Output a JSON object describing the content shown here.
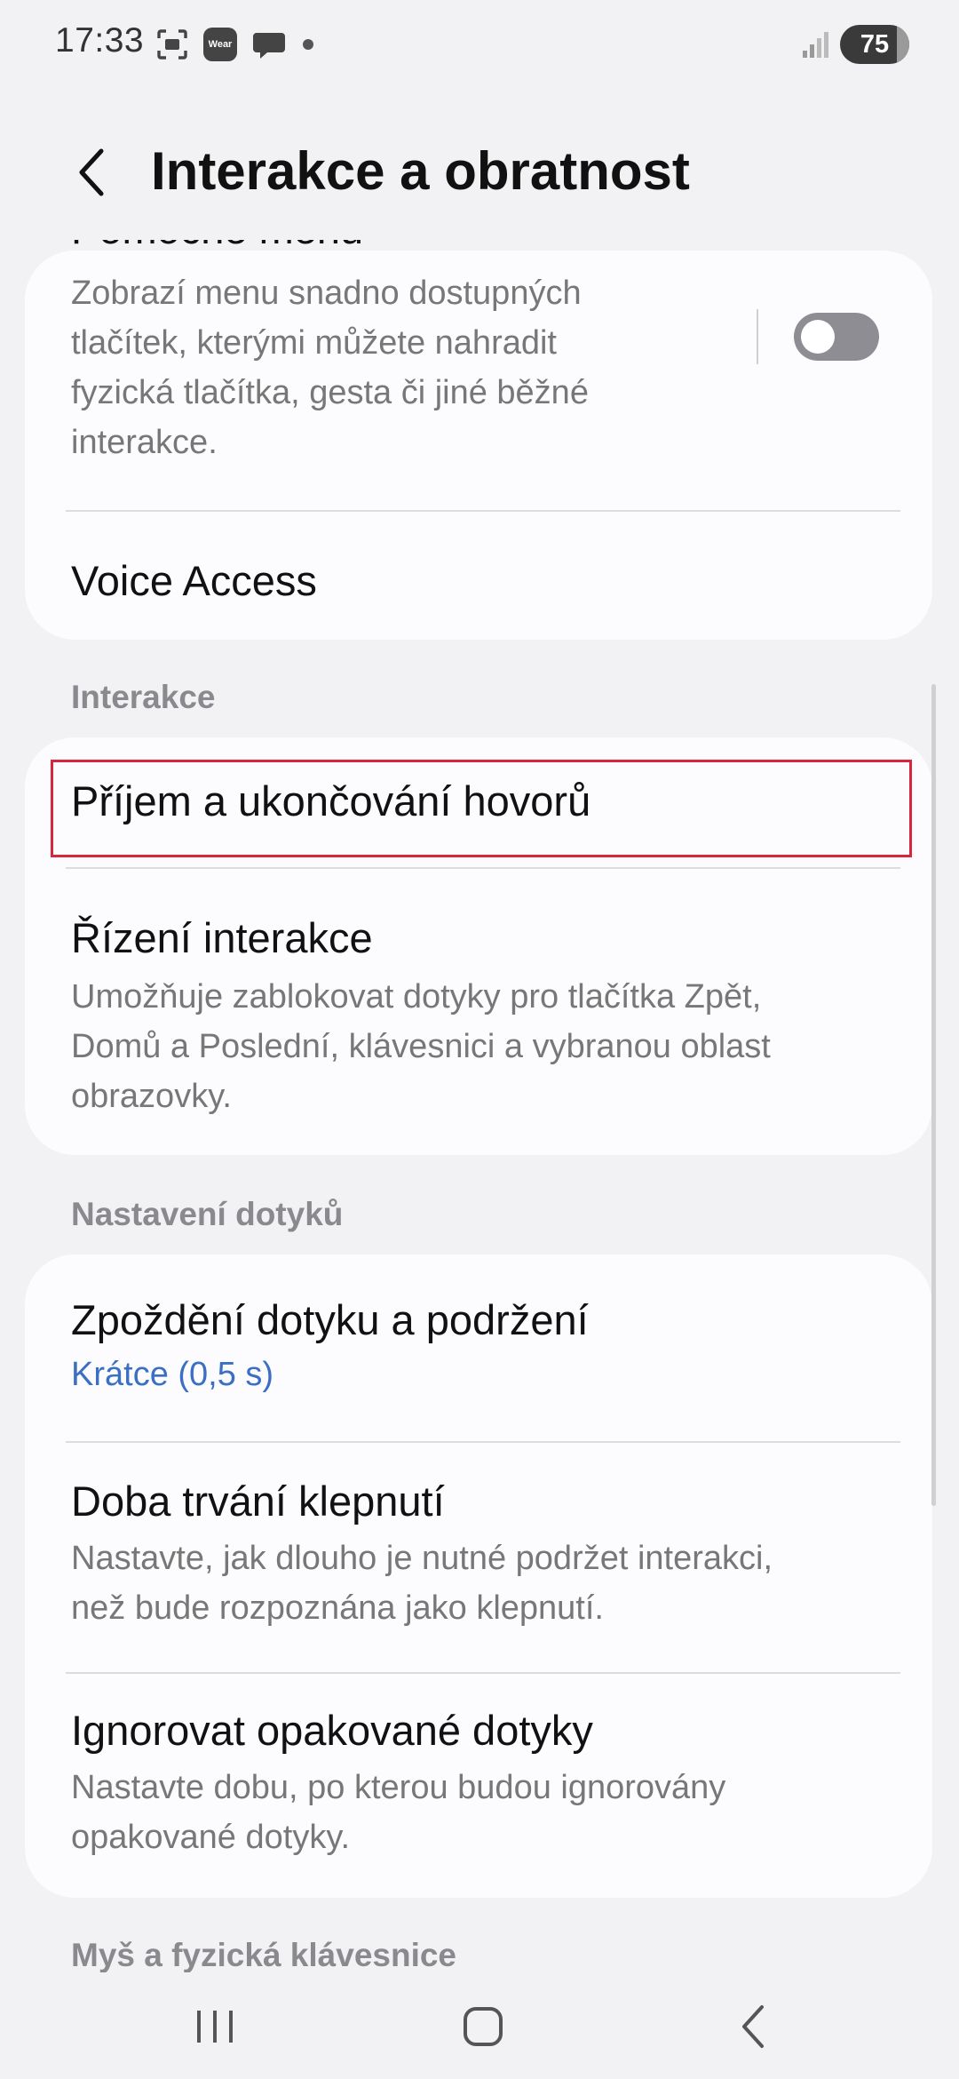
{
  "status_bar": {
    "time": "17:33",
    "icons": [
      "screenshot-icon",
      "wear-icon",
      "chat-bubble-icon",
      "dot-icon"
    ],
    "wear_label": "Wear",
    "signal": "signal-icon",
    "battery": "75"
  },
  "header": {
    "title": "Interakce a obratnost",
    "back": "back-arrow-icon"
  },
  "card1": {
    "partial_title": "Pomocné menu",
    "description": "Zobrazí menu snadno dostupných tlačítek, kterými můžete nahradit fyzická tlačítka, gesta či jiné běžné interakce.",
    "desc_lines": [
      "Zobrazí menu snadno dostupných",
      "tlačítek, kterými můžete nahradit",
      "fyzická tlačítka, gesta či jiné běžné",
      "interakce."
    ],
    "toggle_on": false,
    "voice_access": "Voice Access"
  },
  "section_interakce": "Interakce",
  "card2": {
    "item1": "Příjem a ukončování hovorů",
    "item2_title": "Řízení interakce",
    "item2_lines": [
      "Umožňuje zablokovat dotyky pro tlačítka Zpět,",
      "Domů a Poslední, klávesnici a vybranou oblast",
      "obrazovky."
    ]
  },
  "section_dotyky": "Nastavení dotyků",
  "card3": {
    "item1_title": "Zpoždění dotyku a podržení",
    "item1_value": "Krátce (0,5 s)",
    "item2_title": "Doba trvání klepnutí",
    "item2_lines": [
      "Nastavte, jak dlouho je nutné podržet interakci,",
      "než bude rozpoznána jako klepnutí."
    ],
    "item3_title": "Ignorovat opakované dotyky",
    "item3_lines": [
      "Nastavte dobu, po kterou budou ignorovány",
      "opakované dotyky."
    ]
  },
  "section_mys": "Myš a fyzická klávesnice",
  "colors": {
    "background": "#f2f2f4",
    "card": "#fcfcfe",
    "accent_blue": "#3a6fc4",
    "highlight_red": "#d7263d"
  },
  "navbar": {
    "recents": "recents-icon",
    "home": "home-icon",
    "back": "back-icon"
  }
}
